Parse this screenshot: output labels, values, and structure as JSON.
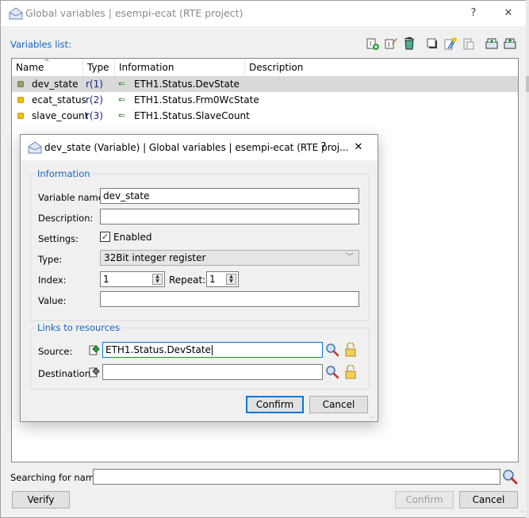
{
  "window": {
    "title": "Global variables | esempi-ecat (RTE project)",
    "help_label": "?",
    "close_label": "✕"
  },
  "toolbar": {
    "list_label": "Variables list:",
    "icons": [
      "add-variable-icon",
      "edit-variable-icon",
      "delete-icon",
      "copy-icon",
      "cut-icon",
      "paste-icon",
      "import-icon",
      "export-icon"
    ]
  },
  "table": {
    "columns": [
      "Name",
      "Type",
      "Information",
      "Description"
    ],
    "sort_indicator": "^",
    "rows": [
      {
        "name": "dev_state",
        "type": "r(1)",
        "information": "ETH1.Status.DevState",
        "description": "",
        "status_color": "#9e9e6e",
        "selected": true
      },
      {
        "name": "ecat_status",
        "type": "r(2)",
        "information": "ETH1.Status.Frm0WcState",
        "description": "",
        "status_color": "#f0c000",
        "selected": false
      },
      {
        "name": "slave_count",
        "type": "r(3)",
        "information": "ETH1.Status.SlaveCount",
        "description": "",
        "status_color": "#f0c000",
        "selected": false
      }
    ],
    "link_arrow": "⇐"
  },
  "search": {
    "label": "Searching for name:",
    "value": "",
    "placeholder": ""
  },
  "footer": {
    "verify_label": "Verify",
    "confirm_label": "Confirm",
    "cancel_label": "Cancel"
  },
  "dialog": {
    "title": "dev_state (Variable) | Global variables | esempi-ecat (RTE proj...",
    "help_label": "?",
    "close_label": "✕",
    "information": {
      "group_label": "Information",
      "variable_name_label": "Variable name:",
      "variable_name_value": "dev_state",
      "description_label": "Description:",
      "description_value": "",
      "settings_label": "Settings:",
      "enabled_label": "Enabled",
      "enabled_checked": true,
      "check_glyph": "✓",
      "type_label": "Type:",
      "type_value": "32Bit integer register",
      "type_arrow": "﹀",
      "index_label": "Index:",
      "index_value": "1",
      "repeat_label": "Repeat:",
      "repeat_value": "1",
      "value_label": "Value:",
      "value_value": ""
    },
    "links": {
      "group_label": "Links to resources",
      "source_label": "Source:",
      "source_value": "ETH1.Status.DevState",
      "destination_label": "Destination:",
      "destination_value": ""
    },
    "confirm_label": "Confirm",
    "cancel_label": "Cancel"
  },
  "colors": {
    "accent": "#0078d7",
    "label_blue": "#1565c0",
    "selection": "#d9d9d9",
    "type_text": "#1a237e",
    "link_arrow": "#2e7d32"
  }
}
